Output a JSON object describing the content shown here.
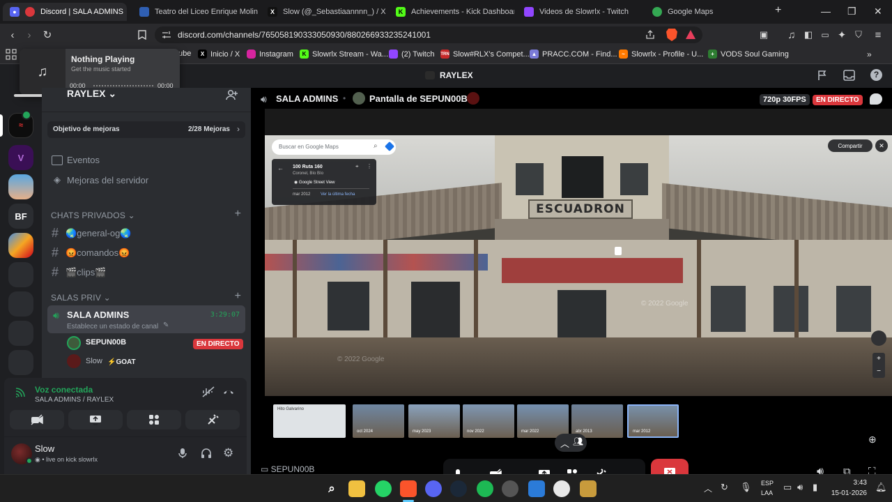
{
  "browser": {
    "tabs": [
      {
        "label": "Discord | SALA ADMINS",
        "icon": "discord-icon",
        "color": "#5865f2",
        "active": true
      },
      {
        "label": "Teatro del Liceo Enrique Molina",
        "icon": "flag-icon",
        "color": "#2f5fb3"
      },
      {
        "label": "Slow (@_Sebastiaannnn_) / X",
        "icon": "x-icon",
        "color": "#111111"
      },
      {
        "label": "Achievements - Kick Dashboard",
        "icon": "kick-icon",
        "color": "#53fc18"
      },
      {
        "label": "Videos de Slowrlx - Twitch",
        "icon": "twitch-icon",
        "color": "#9146ff"
      },
      {
        "label": "Google Maps",
        "icon": "maps-pin-icon",
        "color": "#34a853"
      }
    ],
    "new_tab": "+",
    "url": "discord.com/channels/765058190333050930/880266933235241001",
    "bookmarks": [
      {
        "label": "Inicio / X",
        "icon": "x-icon",
        "color": "#000000"
      },
      {
        "label": "Instagram",
        "icon": "instagram-icon",
        "color": "#d6249f"
      },
      {
        "label": "Slowrlx Stream - Wa...",
        "icon": "kick-icon",
        "color": "#53fc18"
      },
      {
        "label": "(2) Twitch",
        "icon": "twitch-icon",
        "color": "#9146ff"
      },
      {
        "label": "Slow#RLX's Compet...",
        "icon": "tracker-icon",
        "color": "#c62828"
      },
      {
        "label": "PRACC.COM - Find...",
        "icon": "pracc-icon",
        "color": "#7b7bd8"
      },
      {
        "label": "Slowrlx - Profile - U...",
        "icon": "uptime-icon",
        "color": "#ff7a00"
      },
      {
        "label": "VODS Soul Gaming",
        "icon": "vods-icon",
        "color": "#2e7d32"
      }
    ],
    "bookmarks_partial": "ube"
  },
  "media_popup": {
    "title": "Nothing Playing",
    "subtitle": "Get the music started",
    "time_start": "00:00",
    "time_end": "00:00"
  },
  "discord": {
    "server_title": "RAYLEX",
    "server_name": "RAYLEX",
    "server_initials": "BF",
    "boost_goal": {
      "label": "Objetivo de mejoras",
      "progress": "2/28 Mejoras"
    },
    "menu": [
      {
        "label": "Eventos",
        "icon": "calendar-icon"
      },
      {
        "label": "Mejoras del servidor",
        "icon": "boost-icon"
      }
    ],
    "categories": [
      {
        "label": "CHATS PRIVADOS",
        "channels": [
          "🌏general-og🌏",
          "😡comandos😡",
          "🎬clips🎬"
        ]
      },
      {
        "label": "SALAS PRIV"
      }
    ],
    "voice_channel": {
      "name": "SALA ADMINS",
      "timer": "3:29:07",
      "status": "Establece un estado de canal",
      "members": [
        {
          "name": "SEPUN00B",
          "badge": "EN DIRECTO"
        },
        {
          "name": "Slow",
          "tag": "⚡GOAT"
        }
      ]
    },
    "voice_panel": {
      "title": "Voz conectada",
      "subtitle": "SALA ADMINS / RAYLEX"
    },
    "user": {
      "name": "Slow",
      "status": "live on kick slowrlx"
    },
    "stream": {
      "channel": "SALA ADMINS",
      "screen_label": "Pantalla de SEPUN00B",
      "quality": "720p 30FPS",
      "live": "EN DIRECTO",
      "streamer": "SEPUN00B"
    },
    "maps": {
      "search_placeholder": "Buscar en Google Maps",
      "place": "100 Ruta 160",
      "locality": "Coronel, Bío Bío",
      "street_view": "Google Street View",
      "date": "mar 2012",
      "latest_link": "Ver la última fecha",
      "share": "Compartir",
      "sign": "ESCUADRON",
      "watermark": "© 2022 Google",
      "watermark2": "© 2022 Google",
      "thumbs": [
        {
          "label": "Hito Galvarino"
        },
        {
          "label": "oct 2024"
        },
        {
          "label": "may 2023"
        },
        {
          "label": "nov 2022"
        },
        {
          "label": "mar 2022"
        },
        {
          "label": "abr 2013"
        },
        {
          "label": "mar 2012"
        }
      ]
    }
  },
  "taskbar": {
    "lang": "ESP",
    "layout": "LAA",
    "time": "3:43",
    "date": "15-01-2026"
  }
}
